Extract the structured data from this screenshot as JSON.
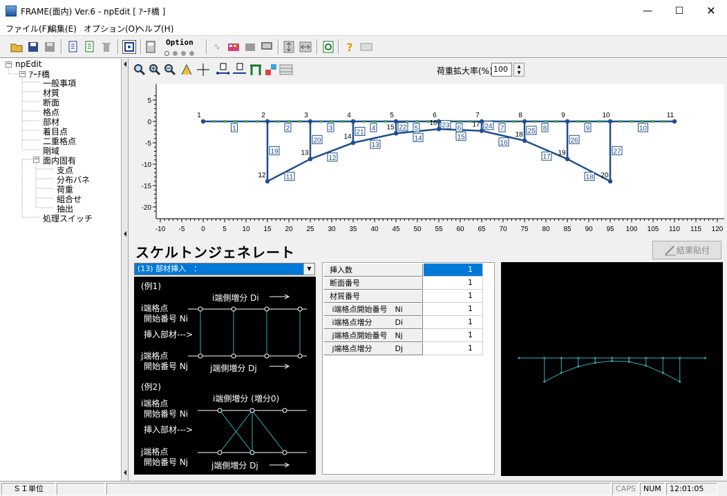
{
  "window": {
    "title": "FRAME(面内) Ver.6 - npEdit [ ｱｰﾁ橋 ]"
  },
  "window_controls": {
    "minimize": "—",
    "maximize": "☐",
    "close": "✕"
  },
  "menu": [
    "ファイル(F)",
    "編集(E)",
    "オプション(O)",
    "ヘルプ(H)"
  ],
  "toolbar": {
    "option_label": "Option"
  },
  "tree": {
    "root": "npEdit",
    "child": "ｱｰﾁ橋",
    "items": [
      "一般事項",
      "材質",
      "断面",
      "格点",
      "部材",
      "着目点",
      "二重格点",
      "剛域"
    ],
    "group": "面内固有",
    "group_items": [
      "支点",
      "分布バネ",
      "荷重",
      "組合せ",
      "抽出"
    ],
    "last": "処理スイッチ"
  },
  "subtoolbar": {
    "scale_label": "荷重拡大率(%)",
    "scale_value": "100"
  },
  "chart_data": {
    "type": "scatter",
    "title": "",
    "xlabel": "",
    "ylabel": "",
    "xlim": [
      -10,
      120
    ],
    "ylim": [
      -22,
      7
    ],
    "xticks": [
      -10,
      -5,
      0,
      5,
      10,
      15,
      20,
      25,
      30,
      35,
      40,
      45,
      50,
      55,
      60,
      65,
      70,
      75,
      80,
      85,
      90,
      95,
      100,
      105,
      110,
      115,
      120
    ],
    "yticks": [
      5,
      0,
      -5,
      -10,
      -15,
      -20
    ],
    "nodes": [
      {
        "id": "1",
        "x": 0,
        "y": 0
      },
      {
        "id": "2",
        "x": 15,
        "y": 0
      },
      {
        "id": "3",
        "x": 25,
        "y": 0
      },
      {
        "id": "4",
        "x": 35,
        "y": 0
      },
      {
        "id": "5",
        "x": 45,
        "y": 0
      },
      {
        "id": "6",
        "x": 55,
        "y": 0
      },
      {
        "id": "7",
        "x": 65,
        "y": 0
      },
      {
        "id": "8",
        "x": 75,
        "y": 0
      },
      {
        "id": "9",
        "x": 85,
        "y": 0
      },
      {
        "id": "10",
        "x": 95,
        "y": 0
      },
      {
        "id": "11",
        "x": 110,
        "y": 0
      },
      {
        "id": "12",
        "x": 15,
        "y": -14
      },
      {
        "id": "13",
        "x": 25,
        "y": -8.8
      },
      {
        "id": "14",
        "x": 35,
        "y": -5
      },
      {
        "id": "15",
        "x": 45,
        "y": -2.8
      },
      {
        "id": "16",
        "x": 55,
        "y": -1.8
      },
      {
        "id": "17",
        "x": 65,
        "y": -2.2
      },
      {
        "id": "18",
        "x": 75,
        "y": -4.5
      },
      {
        "id": "19",
        "x": 85,
        "y": -8.8
      },
      {
        "id": "20",
        "x": 95,
        "y": -14
      }
    ],
    "members": [
      {
        "id": "1",
        "from": "1",
        "to": "2"
      },
      {
        "id": "2",
        "from": "2",
        "to": "3"
      },
      {
        "id": "3",
        "from": "3",
        "to": "4"
      },
      {
        "id": "4",
        "from": "4",
        "to": "5"
      },
      {
        "id": "5",
        "from": "5",
        "to": "6"
      },
      {
        "id": "6",
        "from": "6",
        "to": "7"
      },
      {
        "id": "7",
        "from": "7",
        "to": "8"
      },
      {
        "id": "8",
        "from": "8",
        "to": "9"
      },
      {
        "id": "9",
        "from": "9",
        "to": "10"
      },
      {
        "id": "10",
        "from": "10",
        "to": "11"
      },
      {
        "id": "11",
        "from": "12",
        "to": "13"
      },
      {
        "id": "12",
        "from": "13",
        "to": "14"
      },
      {
        "id": "13",
        "from": "14",
        "to": "15"
      },
      {
        "id": "14",
        "from": "15",
        "to": "16"
      },
      {
        "id": "15",
        "from": "16",
        "to": "17"
      },
      {
        "id": "16",
        "from": "17",
        "to": "18"
      },
      {
        "id": "17",
        "from": "18",
        "to": "19"
      },
      {
        "id": "18",
        "from": "19",
        "to": "20"
      },
      {
        "id": "19",
        "from": "2",
        "to": "12"
      },
      {
        "id": "20",
        "from": "3",
        "to": "13"
      },
      {
        "id": "21",
        "from": "4",
        "to": "14"
      },
      {
        "id": "22",
        "from": "5",
        "to": "15"
      },
      {
        "id": "23",
        "from": "6",
        "to": "16"
      },
      {
        "id": "24",
        "from": "7",
        "to": "17"
      },
      {
        "id": "25",
        "from": "8",
        "to": "18"
      },
      {
        "id": "26",
        "from": "9",
        "to": "19"
      },
      {
        "id": "27",
        "from": "10",
        "to": "20"
      }
    ],
    "member_color": "#1f4e8c",
    "grid": false
  },
  "skeleton": {
    "title": "スケルトンジェネレート",
    "paste_button": "結果貼付",
    "combo_value": "(13) 部材挿入　：",
    "example": {
      "ex1": "(例1)",
      "i_inc": "i端側増分 Di",
      "i_node": "i端格点",
      "i_start": "開始番号 Ni",
      "insert": "挿入部材--->",
      "j_node": "j端格点",
      "j_start": "開始番号 Nj",
      "j_inc": "j端側増分 Dj",
      "ex2": "(例2)",
      "i_inc2": "i端側増分 (増分0)",
      "i_node2": "i端格点",
      "i_start2": "開始番号 Ni",
      "insert2": "挿入部材--->",
      "j_node2": "j端格点",
      "j_start2": "開始番号 Nj",
      "j_inc2": "j端側増分 Dj"
    },
    "params": [
      {
        "label": "挿入数",
        "value": "1"
      },
      {
        "label": "断面番号",
        "value": "1"
      },
      {
        "label": "材質番号",
        "value": "1"
      },
      {
        "label": " i端格点開始番号　Ni",
        "value": "1"
      },
      {
        "label": " i端格点増分　　　Di",
        "value": "1"
      },
      {
        "label": " j端格点開始番号　Nj",
        "value": "1"
      },
      {
        "label": " j端格点増分　　　Dj",
        "value": "1"
      }
    ],
    "preview_color": "#2ab0b8"
  },
  "status": {
    "unit": "ＳＩ単位",
    "caps": "CAPS",
    "num": "NUM",
    "time": "12:01:05"
  }
}
